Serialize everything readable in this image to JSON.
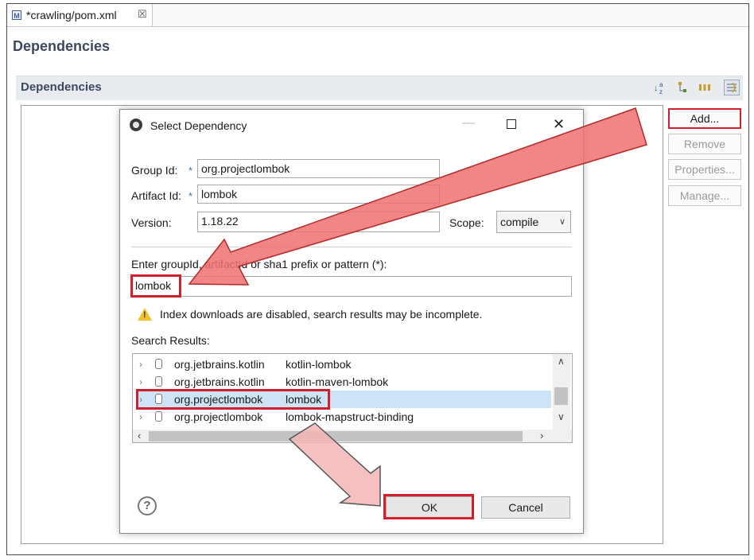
{
  "editor": {
    "tab_title": "*crawling/pom.xml",
    "tab_close": "☒",
    "page_title": "Dependencies",
    "section_title": "Dependencies",
    "toolbar_icons": [
      "sort-az-icon",
      "hierarchy-icon",
      "columns-icon",
      "filter-icon"
    ],
    "buttons": {
      "add": "Add...",
      "remove": "Remove",
      "properties": "Properties...",
      "manage": "Manage..."
    }
  },
  "dialog": {
    "title": "Select Dependency",
    "group_id_label": "Group Id:",
    "group_id_value": "org.projectlombok",
    "artifact_id_label": "Artifact Id:",
    "artifact_id_value": "lombok",
    "version_label": "Version:",
    "version_value": "1.18.22",
    "scope_label": "Scope:",
    "scope_value": "compile",
    "required_mark": "*",
    "search_label": "Enter groupId, artifactId or sha1 prefix or pattern (*):",
    "search_value": "lombok",
    "warning": "Index downloads are disabled, search results may be incomplete.",
    "results_label": "Search Results:",
    "results": [
      {
        "group": "org.jetbrains.kotlin",
        "artifact": "kotlin-lombok",
        "selected": false
      },
      {
        "group": "org.jetbrains.kotlin",
        "artifact": "kotlin-maven-lombok",
        "selected": false
      },
      {
        "group": "org.projectlombok",
        "artifact": "lombok",
        "selected": true
      },
      {
        "group": "org.projectlombok",
        "artifact": "lombok-mapstruct-binding",
        "selected": false
      }
    ],
    "ok": "OK",
    "cancel": "Cancel",
    "help": "?"
  },
  "colors": {
    "highlight": "#d0202a",
    "arrow_fill": "#f07a7a",
    "selection": "#cde4f7"
  }
}
